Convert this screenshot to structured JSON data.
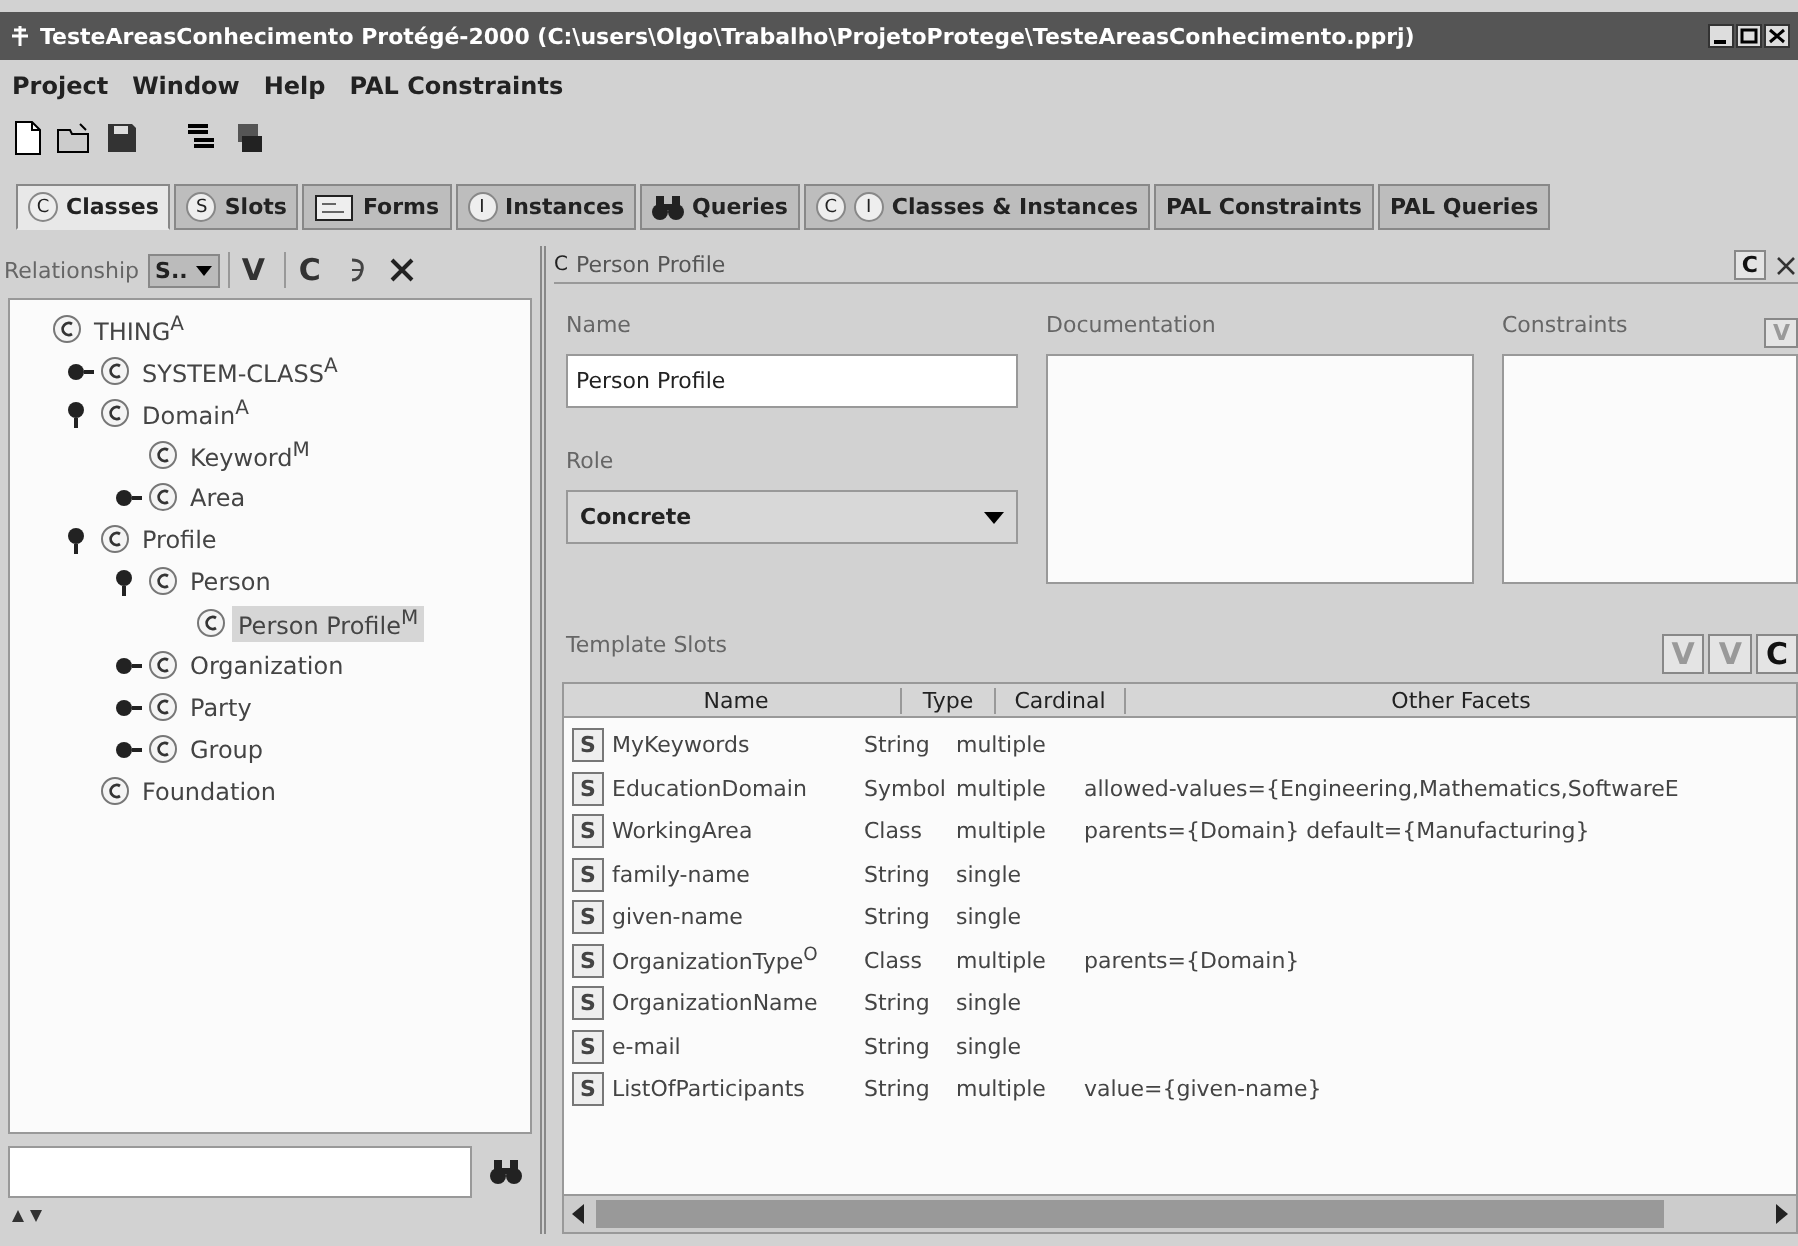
{
  "window": {
    "title": "TesteAreasConhecimento  Protégé-2000   (C:\\users\\Olgo\\Trabalho\\ProjetoProtege\\TesteAreasConhecimento.pprj)"
  },
  "menu": [
    "Project",
    "Window",
    "Help",
    "PAL Constraints"
  ],
  "tabs": [
    {
      "letters": [
        "C"
      ],
      "label": "Classes",
      "selected": true
    },
    {
      "letters": [
        "S"
      ],
      "label": "Slots",
      "selected": false
    },
    {
      "kind": "form",
      "label": "Forms",
      "selected": false
    },
    {
      "letters": [
        "I"
      ],
      "label": "Instances",
      "selected": false
    },
    {
      "kind": "binoculars",
      "label": "Queries",
      "selected": false
    },
    {
      "letters": [
        "C",
        "I"
      ],
      "label": "Classes & Instances",
      "selected": false
    },
    {
      "label": "PAL Constraints",
      "selected": false
    },
    {
      "label": "PAL Queries",
      "selected": false
    }
  ],
  "class_browser": {
    "relationship_label": "Relationship",
    "relationship_value": "S..",
    "buttons": [
      "V",
      "C"
    ],
    "tree": [
      {
        "label": "THING$^{A}$",
        "selected": false,
        "children": [
          {
            "label": "SYSTEM-CLASS$^{A}$",
            "expanded": false,
            "selected": false
          },
          {
            "label": "Domain$^{A}$",
            "expanded": true,
            "selected": false,
            "children": [
              {
                "label": "Keyword$^{M}$",
                "selected": false
              },
              {
                "label": "Area",
                "expanded": false,
                "selected": false
              }
            ]
          },
          {
            "label": "Profile",
            "expanded": true,
            "selected": false,
            "children": [
              {
                "label": "Person",
                "expanded": true,
                "selected": false,
                "children": [
                  {
                    "label": "Person Profile$^{M}$",
                    "selected": true
                  }
                ]
              },
              {
                "label": "Organization",
                "expanded": false,
                "selected": false
              },
              {
                "label": "Party",
                "expanded": false,
                "selected": false
              },
              {
                "label": "Group",
                "expanded": false,
                "selected": false
              }
            ]
          },
          {
            "label": "Foundation",
            "selected": false
          }
        ]
      }
    ]
  },
  "class_form": {
    "header_badge": "C",
    "header": "Person Profile",
    "header_button": "C",
    "name_label": "Name",
    "name_value": "Person Profile",
    "documentation_label": "Documentation",
    "constraints_label": "Constraints",
    "constraints_button": "V",
    "role_label": "Role",
    "role_value": "Concrete",
    "slots_label": "Template Slots",
    "slot_buttons": [
      {
        "label": "V",
        "disabled": true
      },
      {
        "label": "V",
        "disabled": true
      },
      {
        "label": "C",
        "disabled": false
      }
    ],
    "table": {
      "columns": [
        "Name",
        "Type",
        "Cardinal",
        "Other Facets"
      ],
      "rows": [
        {
          "badge": "S",
          "name": "MyKeywords",
          "type": "String",
          "cardinality": "multiple"
        },
        {
          "badge": "S",
          "name": "EducationDomain",
          "type": "Symbol",
          "cardinality": "multiple",
          "facets": "allowed-values={Engineering,Mathematics,SoftwareE"
        },
        {
          "badge": "S",
          "name": "WorkingArea",
          "type": "Class",
          "cardinality": "multiple",
          "facets": "parents={Domain} default={Manufacturing}"
        },
        {
          "badge": "S",
          "name": "family-name",
          "type": "String",
          "cardinality": "single"
        },
        {
          "badge": "S",
          "name": "given-name",
          "type": "String",
          "cardinality": "single"
        },
        {
          "badge": "S",
          "name": "OrganizationType$^{O}$",
          "type": "Class",
          "cardinality": "multiple",
          "facets": "parents={Domain}"
        },
        {
          "badge": "S",
          "name": "OrganizationName",
          "type": "String",
          "cardinality": "single"
        },
        {
          "badge": "S",
          "name": "e-mail",
          "type": "String",
          "cardinality": "single"
        },
        {
          "badge": "S",
          "name": "ListOfParticipants",
          "type": "String",
          "cardinality": "multiple",
          "facets": "value={given-name}"
        }
      ]
    }
  }
}
